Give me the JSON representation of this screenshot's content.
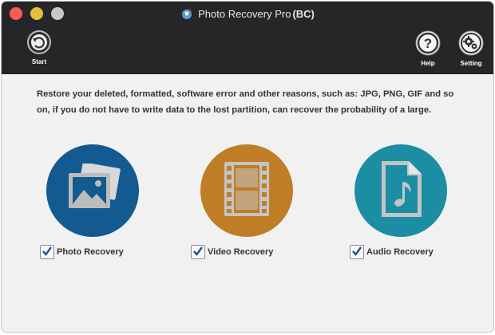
{
  "window": {
    "title": "Photo Recovery Pro",
    "title_suffix": "(BC)"
  },
  "toolbar": {
    "start_label": "Start",
    "help_label": "Help",
    "setting_label": "Setting"
  },
  "main": {
    "description": "Restore your deleted, formatted, software error and other reasons, such as: JPG, PNG, GIF and so on, if you do not have to write data to the lost partition, can recover the probability of a large.",
    "options": [
      {
        "label": "Photo Recovery",
        "checked": true,
        "icon": "image-icon",
        "color": "#125a8f"
      },
      {
        "label": "Video Recovery",
        "checked": true,
        "icon": "film-icon",
        "color": "#bf7d26"
      },
      {
        "label": "Audio Recovery",
        "checked": true,
        "icon": "music-file-icon",
        "color": "#1c8ea3"
      }
    ]
  },
  "colors": {
    "toolbar_bg": "#262629",
    "content_bg": "#f1f1f1"
  }
}
